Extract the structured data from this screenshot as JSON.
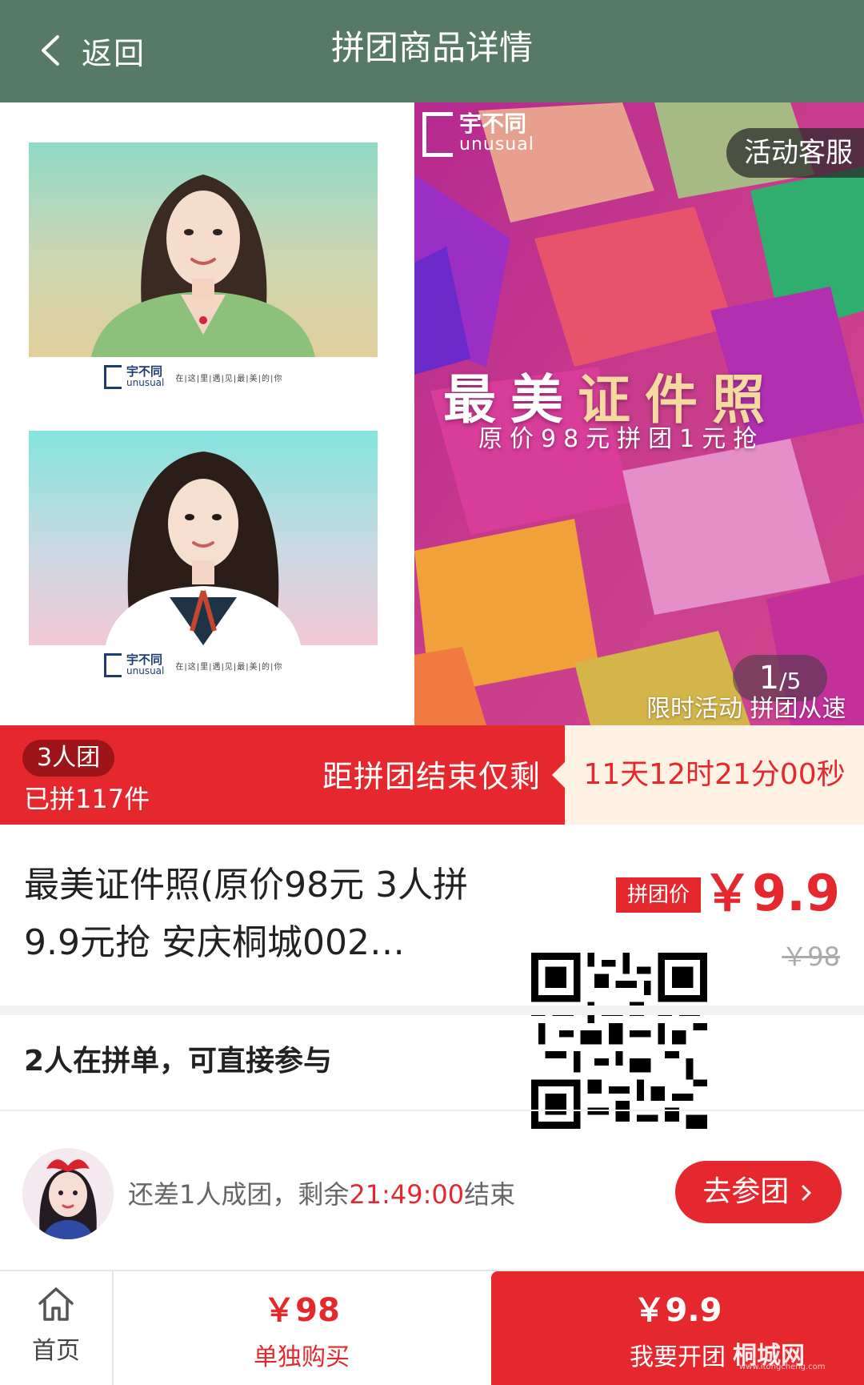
{
  "header": {
    "back_label": "返回",
    "title": "拼团商品详情"
  },
  "banner": {
    "brand_cn": "宇不同",
    "brand_en": "unusual",
    "card_slogan": "在|这|里|遇|见|最|美|的|你",
    "service_label": "活动客服",
    "promo_title": "最美证件照",
    "promo_subtitle": "原价98元拼团1元抢",
    "pager_current": "1",
    "pager_separator": "/",
    "pager_total": "5",
    "caption": "限时活动 拼团从速",
    "colors": {
      "accent_gold": "#f5d9a0"
    }
  },
  "group_bar": {
    "team_size": "3人团",
    "sold": "已拼117件",
    "countdown_label": "距拼团结束仅剩",
    "countdown_value": "11天12时21分00秒"
  },
  "product": {
    "name": "最美证件照(原价98元 3人拼9.9元抢 安庆桐城002…",
    "price_tag": "拼团价",
    "group_price": "￥9.9",
    "original_price": "￥98"
  },
  "joining": {
    "title": "2人在拼单，可直接参与",
    "status_prefix": "还差1人成团，剩余",
    "status_time": "21:49:00",
    "status_suffix": "结束",
    "join_button": "去参团"
  },
  "bottom_bar": {
    "home_label": "首页",
    "single_price": "￥98",
    "single_label": "单独购买",
    "group_price": "￥9.9",
    "group_label": "我要开团",
    "watermark_cn": "桐城网",
    "watermark_url": "www.itongcheng.com"
  },
  "icons": [
    "chevron-left-icon",
    "home-icon",
    "chevron-right-icon",
    "qr-code-icon"
  ],
  "colors": {
    "header_bg": "#577a66",
    "brand_red": "#e4282e",
    "countdown_bg": "#fdf1e4"
  }
}
